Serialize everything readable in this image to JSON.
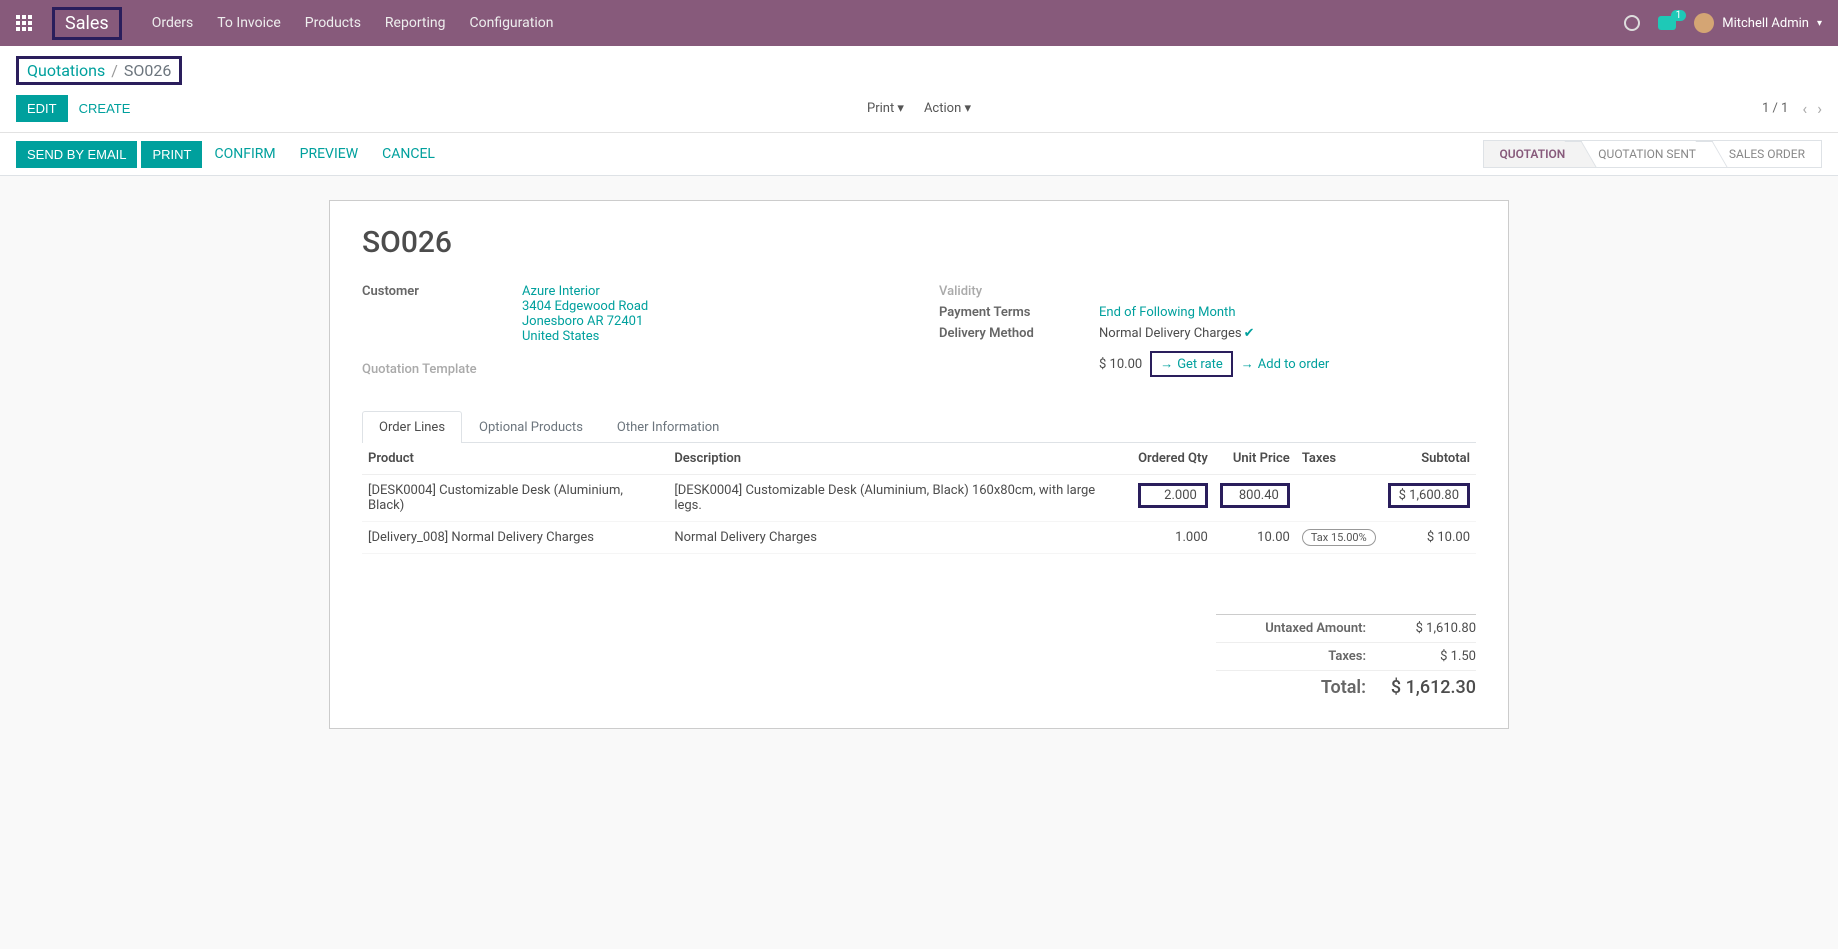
{
  "nav": {
    "brand": "Sales",
    "menu": [
      "Orders",
      "To Invoice",
      "Products",
      "Reporting",
      "Configuration"
    ],
    "chat_badge": "1",
    "user": "Mitchell Admin"
  },
  "breadcrumb": {
    "parent": "Quotations",
    "current": "SO026"
  },
  "buttons": {
    "edit": "EDIT",
    "create": "CREATE",
    "print_dd": "Print",
    "action_dd": "Action"
  },
  "pager": "1 / 1",
  "actions": {
    "send_email": "SEND BY EMAIL",
    "print": "PRINT",
    "confirm": "CONFIRM",
    "preview": "PREVIEW",
    "cancel": "CANCEL"
  },
  "status": [
    "QUOTATION",
    "QUOTATION SENT",
    "SALES ORDER"
  ],
  "record": {
    "name": "SO026",
    "labels": {
      "customer": "Customer",
      "quotation_template": "Quotation Template",
      "validity": "Validity",
      "payment_terms": "Payment Terms",
      "delivery_method": "Delivery Method"
    },
    "customer": {
      "name": "Azure Interior",
      "street": "3404 Edgewood Road",
      "city": "Jonesboro AR 72401",
      "country": "United States"
    },
    "payment_terms": "End of Following Month",
    "delivery_method": "Normal Delivery Charges",
    "delivery_price": "$ 10.00",
    "get_rate": "Get rate",
    "add_to_order": "Add to order"
  },
  "tabs": [
    "Order Lines",
    "Optional Products",
    "Other Information"
  ],
  "table": {
    "headers": {
      "product": "Product",
      "description": "Description",
      "qty": "Ordered Qty",
      "unit_price": "Unit Price",
      "taxes": "Taxes",
      "subtotal": "Subtotal"
    },
    "rows": [
      {
        "product": "[DESK0004] Customizable Desk (Aluminium, Black)",
        "description": "[DESK0004] Customizable Desk (Aluminium, Black) 160x80cm, with large legs.",
        "qty": "2.000",
        "unit_price": "800.40",
        "taxes": "",
        "subtotal": "$ 1,600.80",
        "hl": true
      },
      {
        "product": "[Delivery_008] Normal Delivery Charges",
        "description": "Normal Delivery Charges",
        "qty": "1.000",
        "unit_price": "10.00",
        "taxes": "Tax 15.00%",
        "subtotal": "$ 10.00",
        "hl": false
      }
    ]
  },
  "totals": {
    "untaxed_label": "Untaxed Amount:",
    "untaxed": "$ 1,610.80",
    "taxes_label": "Taxes:",
    "taxes": "$ 1.50",
    "total_label": "Total:",
    "total": "$ 1,612.30"
  }
}
